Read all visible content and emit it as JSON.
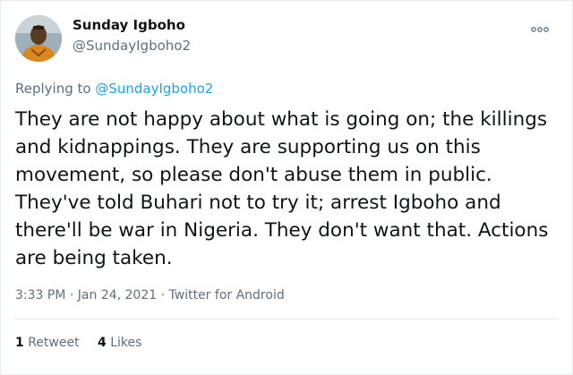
{
  "user": {
    "name": "Sunday Igboho",
    "handle": "@SundayIgboho2"
  },
  "reply": {
    "prefix": "Replying to ",
    "mention": "@SundayIgboho2"
  },
  "tweet": {
    "lines": [
      "They are not happy about what is going on; the killings",
      "and kidnappings. They are supporting us on this",
      "movement, so please don't abuse them in public.",
      "They've told Buhari not to try it; arrest Igboho and",
      "there'll be war in Nigeria. They don't want that. Actions",
      "are being taken."
    ]
  },
  "meta": {
    "time": "3:33 PM",
    "separator": " · ",
    "date": "Jan 24, 2021",
    "client": "Twitter for Android"
  },
  "stats": {
    "retweets_count": "1",
    "retweets_label": "Retweet",
    "likes_count": "4",
    "likes_label": "Likes"
  },
  "icons": {
    "more": "more-options-icon",
    "avatar": "profile-photo"
  },
  "colors": {
    "link": "#1da1f2",
    "secondary_text": "#5b7083",
    "primary_text": "#0f1419"
  }
}
